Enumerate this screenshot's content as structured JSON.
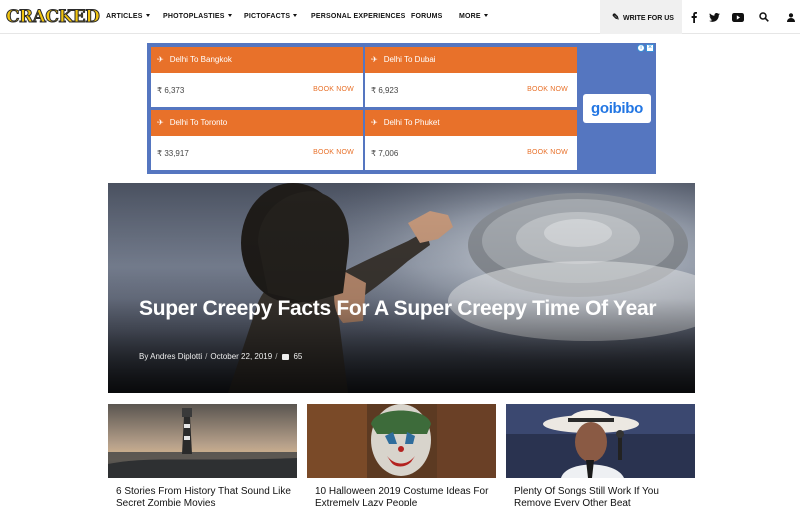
{
  "nav": {
    "logo": "CRACKED",
    "items": [
      {
        "label": "ARTICLES",
        "dropdown": true
      },
      {
        "label": "PHOTOPLASTIES",
        "dropdown": true
      },
      {
        "label": "PICTOFACTS",
        "dropdown": true
      },
      {
        "label": "PERSONAL EXPERIENCES",
        "dropdown": false
      },
      {
        "label": "FORUMS",
        "dropdown": false
      },
      {
        "label": "MORE",
        "dropdown": true
      }
    ],
    "write_label": "WRITE FOR US",
    "icons": [
      "facebook-icon",
      "twitter-icon",
      "youtube-icon",
      "search-icon",
      "user-icon"
    ]
  },
  "ad": {
    "brand": "goibibo",
    "cta": "BOOK NOW",
    "cards": [
      {
        "route": "Delhi To Bangkok",
        "price": "₹ 6,373"
      },
      {
        "route": "Delhi To Dubai",
        "price": "₹ 6,923"
      },
      {
        "route": "Delhi To Toronto",
        "price": "₹ 33,917"
      },
      {
        "route": "Delhi To Phuket",
        "price": "₹ 7,006"
      }
    ],
    "colors": {
      "background": "#5576c0",
      "card_header": "#e8712a"
    }
  },
  "hero": {
    "title": "Super Creepy Facts For A Super Creepy Time Of Year",
    "author": "By Andres Diplotti",
    "date": "October 22, 2019",
    "comments": "65"
  },
  "articles": [
    {
      "title": "6 Stories From History That Sound Like Secret Zombie Movies"
    },
    {
      "title": "10 Halloween 2019 Costume Ideas For Extremely Lazy People"
    },
    {
      "title": "Plenty Of Songs Still Work If You Remove Every Other Beat"
    }
  ]
}
